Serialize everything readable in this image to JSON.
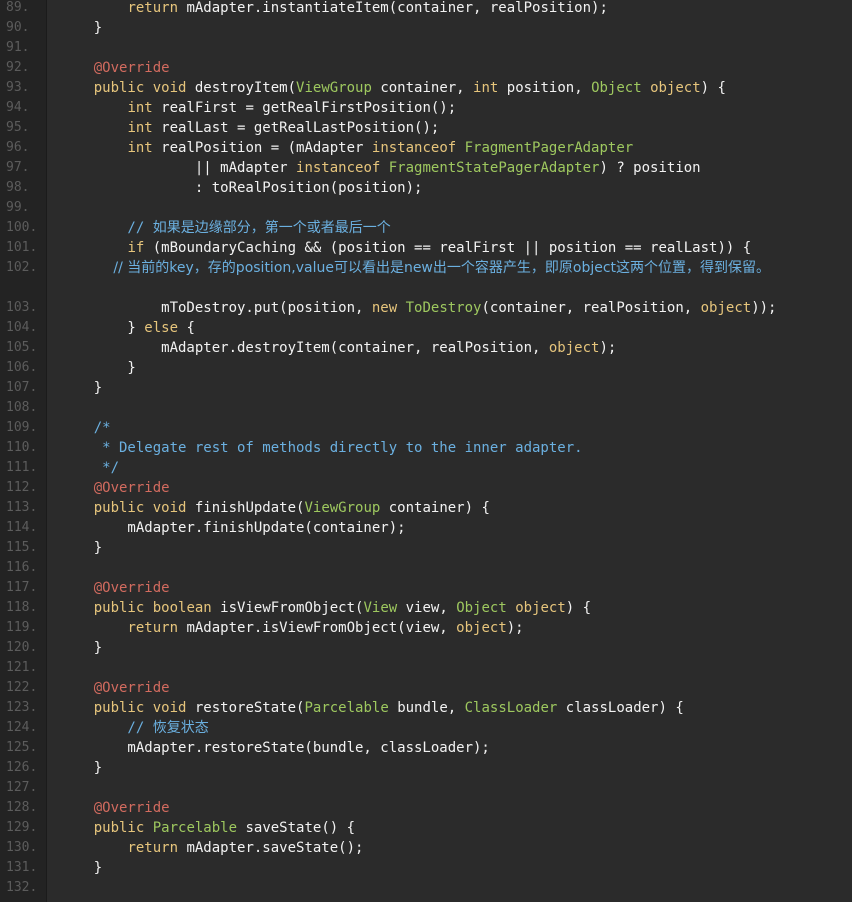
{
  "editor": {
    "colors": {
      "background": "#2b2b2b",
      "gutter": "#232323",
      "line_number": "#5c5c5c",
      "default": "#f2f2f2",
      "keyword": "#e6c57c",
      "type": "#9ec85f",
      "annotation": "#d26b5f",
      "comment": "#6bb0e0"
    },
    "lines": [
      {
        "n": "89.",
        "tokens": [
          [
            "def",
            "        "
          ],
          [
            "kw",
            "return"
          ],
          [
            "def",
            " mAdapter.instantiateItem(container, realPosition);"
          ]
        ]
      },
      {
        "n": "90.",
        "tokens": [
          [
            "def",
            "    }"
          ]
        ]
      },
      {
        "n": "91.",
        "tokens": []
      },
      {
        "n": "92.",
        "tokens": [
          [
            "ann",
            "    @Override"
          ]
        ]
      },
      {
        "n": "93.",
        "tokens": [
          [
            "def",
            "    "
          ],
          [
            "kw",
            "public"
          ],
          [
            "def",
            " "
          ],
          [
            "kw",
            "void"
          ],
          [
            "def",
            " destroyItem("
          ],
          [
            "type",
            "ViewGroup"
          ],
          [
            "def",
            " container, "
          ],
          [
            "kw",
            "int"
          ],
          [
            "def",
            " position, "
          ],
          [
            "type",
            "Object"
          ],
          [
            "def",
            " "
          ],
          [
            "kw",
            "object"
          ],
          [
            "def",
            ") {"
          ]
        ]
      },
      {
        "n": "94.",
        "tokens": [
          [
            "def",
            "        "
          ],
          [
            "kw",
            "int"
          ],
          [
            "def",
            " realFirst = getRealFirstPosition();"
          ]
        ]
      },
      {
        "n": "95.",
        "tokens": [
          [
            "def",
            "        "
          ],
          [
            "kw",
            "int"
          ],
          [
            "def",
            " realLast = getRealLastPosition();"
          ]
        ]
      },
      {
        "n": "96.",
        "tokens": [
          [
            "def",
            "        "
          ],
          [
            "kw",
            "int"
          ],
          [
            "def",
            " realPosition = (mAdapter "
          ],
          [
            "kw",
            "instanceof"
          ],
          [
            "def",
            " "
          ],
          [
            "type",
            "FragmentPagerAdapter"
          ]
        ]
      },
      {
        "n": "97.",
        "tokens": [
          [
            "def",
            "                || mAdapter "
          ],
          [
            "kw",
            "instanceof"
          ],
          [
            "def",
            " "
          ],
          [
            "type",
            "FragmentStatePagerAdapter"
          ],
          [
            "def",
            ") ? position"
          ]
        ]
      },
      {
        "n": "98.",
        "tokens": [
          [
            "def",
            "                : toRealPosition(position);"
          ]
        ]
      },
      {
        "n": "99.",
        "tokens": []
      },
      {
        "n": "100.",
        "tokens": [
          [
            "cm",
            "        // "
          ],
          [
            "cmcjk",
            "如果是边缘部分，第一个或者最后一个"
          ]
        ]
      },
      {
        "n": "101.",
        "tokens": [
          [
            "def",
            "        "
          ],
          [
            "kw",
            "if"
          ],
          [
            "def",
            " (mBoundaryCaching && (position == realFirst || position == realLast)) {"
          ]
        ]
      },
      {
        "n": "102.",
        "wrap": true,
        "tokens": [
          [
            "cm",
            "            // "
          ],
          [
            "cmcjk",
            "当前的key，存的position,value可以看出是new出一个容器产生，即原object这两个位置，得到保留。"
          ]
        ]
      },
      {
        "n": "103.",
        "tokens": [
          [
            "def",
            "            mToDestroy.put(position, "
          ],
          [
            "kw",
            "new"
          ],
          [
            "def",
            " "
          ],
          [
            "type",
            "ToDestroy"
          ],
          [
            "def",
            "(container, realPosition, "
          ],
          [
            "kw",
            "object"
          ],
          [
            "def",
            "));"
          ]
        ]
      },
      {
        "n": "104.",
        "tokens": [
          [
            "def",
            "        } "
          ],
          [
            "kw",
            "else"
          ],
          [
            "def",
            " {"
          ]
        ]
      },
      {
        "n": "105.",
        "tokens": [
          [
            "def",
            "            mAdapter.destroyItem(container, realPosition, "
          ],
          [
            "kw",
            "object"
          ],
          [
            "def",
            ");"
          ]
        ]
      },
      {
        "n": "106.",
        "tokens": [
          [
            "def",
            "        }"
          ]
        ]
      },
      {
        "n": "107.",
        "tokens": [
          [
            "def",
            "    }"
          ]
        ]
      },
      {
        "n": "108.",
        "tokens": []
      },
      {
        "n": "109.",
        "tokens": [
          [
            "cm",
            "    /*"
          ]
        ]
      },
      {
        "n": "110.",
        "tokens": [
          [
            "cm",
            "     * Delegate rest of methods directly to the inner adapter."
          ]
        ]
      },
      {
        "n": "111.",
        "tokens": [
          [
            "cm",
            "     */"
          ]
        ]
      },
      {
        "n": "112.",
        "tokens": [
          [
            "ann",
            "    @Override"
          ]
        ]
      },
      {
        "n": "113.",
        "tokens": [
          [
            "def",
            "    "
          ],
          [
            "kw",
            "public"
          ],
          [
            "def",
            " "
          ],
          [
            "kw",
            "void"
          ],
          [
            "def",
            " finishUpdate("
          ],
          [
            "type",
            "ViewGroup"
          ],
          [
            "def",
            " container) {"
          ]
        ]
      },
      {
        "n": "114.",
        "tokens": [
          [
            "def",
            "        mAdapter.finishUpdate(container);"
          ]
        ]
      },
      {
        "n": "115.",
        "tokens": [
          [
            "def",
            "    }"
          ]
        ]
      },
      {
        "n": "116.",
        "tokens": []
      },
      {
        "n": "117.",
        "tokens": [
          [
            "ann",
            "    @Override"
          ]
        ]
      },
      {
        "n": "118.",
        "tokens": [
          [
            "def",
            "    "
          ],
          [
            "kw",
            "public"
          ],
          [
            "def",
            " "
          ],
          [
            "kw",
            "boolean"
          ],
          [
            "def",
            " isViewFromObject("
          ],
          [
            "type",
            "View"
          ],
          [
            "def",
            " view, "
          ],
          [
            "type",
            "Object"
          ],
          [
            "def",
            " "
          ],
          [
            "kw",
            "object"
          ],
          [
            "def",
            ") {"
          ]
        ]
      },
      {
        "n": "119.",
        "tokens": [
          [
            "def",
            "        "
          ],
          [
            "kw",
            "return"
          ],
          [
            "def",
            " mAdapter.isViewFromObject(view, "
          ],
          [
            "kw",
            "object"
          ],
          [
            "def",
            ");"
          ]
        ]
      },
      {
        "n": "120.",
        "tokens": [
          [
            "def",
            "    }"
          ]
        ]
      },
      {
        "n": "121.",
        "tokens": []
      },
      {
        "n": "122.",
        "tokens": [
          [
            "ann",
            "    @Override"
          ]
        ]
      },
      {
        "n": "123.",
        "tokens": [
          [
            "def",
            "    "
          ],
          [
            "kw",
            "public"
          ],
          [
            "def",
            " "
          ],
          [
            "kw",
            "void"
          ],
          [
            "def",
            " restoreState("
          ],
          [
            "type",
            "Parcelable"
          ],
          [
            "def",
            " bundle, "
          ],
          [
            "type",
            "ClassLoader"
          ],
          [
            "def",
            " classLoader) {"
          ]
        ]
      },
      {
        "n": "124.",
        "tokens": [
          [
            "cm",
            "        // "
          ],
          [
            "cmcjk",
            "恢复状态"
          ]
        ]
      },
      {
        "n": "125.",
        "tokens": [
          [
            "def",
            "        mAdapter.restoreState(bundle, classLoader);"
          ]
        ]
      },
      {
        "n": "126.",
        "tokens": [
          [
            "def",
            "    }"
          ]
        ]
      },
      {
        "n": "127.",
        "tokens": []
      },
      {
        "n": "128.",
        "tokens": [
          [
            "ann",
            "    @Override"
          ]
        ]
      },
      {
        "n": "129.",
        "tokens": [
          [
            "def",
            "    "
          ],
          [
            "kw",
            "public"
          ],
          [
            "def",
            " "
          ],
          [
            "type",
            "Parcelable"
          ],
          [
            "def",
            " saveState() {"
          ]
        ]
      },
      {
        "n": "130.",
        "tokens": [
          [
            "def",
            "        "
          ],
          [
            "kw",
            "return"
          ],
          [
            "def",
            " mAdapter.saveState();"
          ]
        ]
      },
      {
        "n": "131.",
        "tokens": [
          [
            "def",
            "    }"
          ]
        ]
      },
      {
        "n": "132.",
        "tokens": []
      }
    ]
  }
}
